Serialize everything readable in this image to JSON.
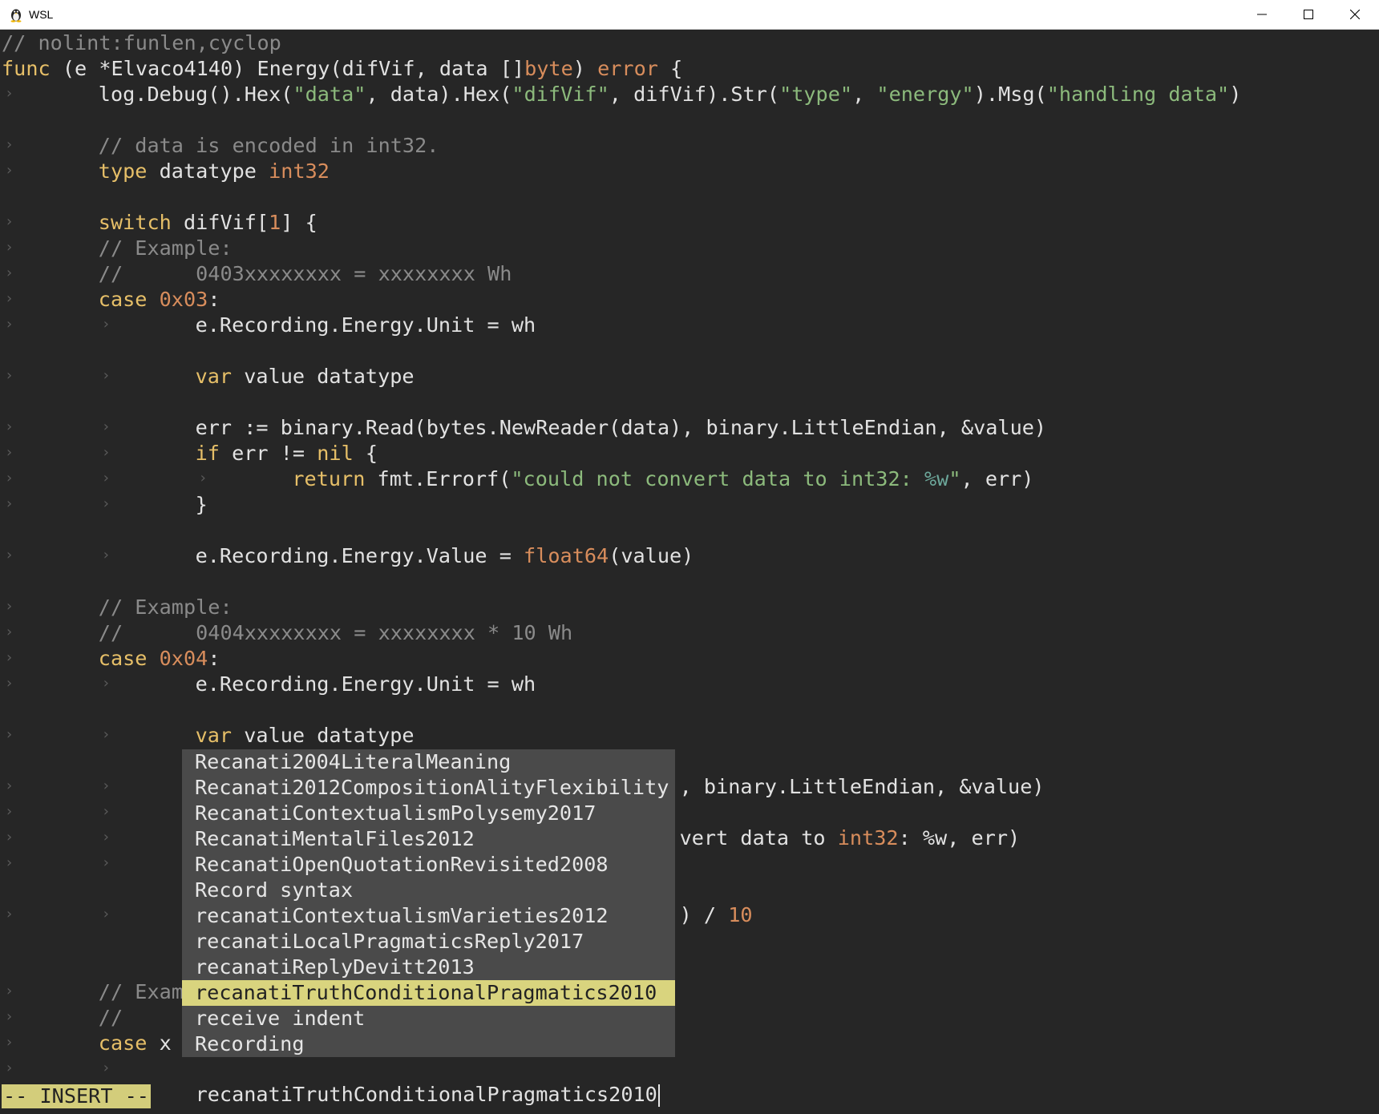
{
  "window": {
    "title": "WSL",
    "icon": "tux-penguin-icon",
    "controls": [
      "minimize-icon",
      "maximize-icon",
      "close-icon"
    ]
  },
  "colors": {
    "background": "#262626",
    "comment": "#8a8a8a",
    "keyword": "#e6bf68",
    "type": "#d88d5c",
    "string": "#8cba7c",
    "text": "#e2e2e2",
    "popup_bg": "#4a4a4a",
    "popup_selected_bg": "#d9d47e",
    "status_bg": "#d3cd7b"
  },
  "lines": [
    {
      "row": 0,
      "text": "// nolint:funlen,cyclop"
    },
    {
      "row": 1,
      "text": "func (e *Elvaco4140) Energy(difVif, data []byte) error {"
    },
    {
      "row": 2,
      "text": "log.Debug().Hex(\"data\", data).Hex(\"difVif\", difVif).Str(\"type\", \"energy\").Msg(\"handling data\")"
    },
    {
      "row": 4,
      "text": "// data is encoded in int32."
    },
    {
      "row": 5,
      "text": "type datatype int32"
    },
    {
      "row": 7,
      "text": "switch difVif[1] {"
    },
    {
      "row": 8,
      "text": "// Example:"
    },
    {
      "row": 9,
      "text": "//      0403xxxxxxxx = xxxxxxxx Wh"
    },
    {
      "row": 10,
      "text": "case 0x03:"
    },
    {
      "row": 11,
      "text": "e.Recording.Energy.Unit = wh"
    },
    {
      "row": 13,
      "text": "var value datatype"
    },
    {
      "row": 15,
      "text": "err := binary.Read(bytes.NewReader(data), binary.LittleEndian, &value)"
    },
    {
      "row": 16,
      "text": "if err != nil {"
    },
    {
      "row": 17,
      "text": "return fmt.Errorf(\"could not convert data to int32: %w\", err)"
    },
    {
      "row": 18,
      "text": "}"
    },
    {
      "row": 20,
      "text": "e.Recording.Energy.Value = float64(value)"
    },
    {
      "row": 22,
      "text": "// Example:"
    },
    {
      "row": 23,
      "text": "//      0404xxxxxxxx = xxxxxxxx * 10 Wh"
    },
    {
      "row": 24,
      "text": "case 0x04:"
    },
    {
      "row": 25,
      "text": "e.Recording.Energy.Unit = wh"
    },
    {
      "row": 27,
      "text": "var value datatype"
    },
    {
      "row": 29,
      "text": ", binary.LittleEndian, &value)"
    },
    {
      "row": 31,
      "text": "vert data to int32: %w\", err)"
    },
    {
      "row": 34,
      "text": ") / 10"
    },
    {
      "row": 37,
      "text": "// Exam"
    },
    {
      "row": 38,
      "text": "//"
    },
    {
      "row": 39,
      "text": "case 0x"
    },
    {
      "row": 41,
      "text": "recanatiTruthConditionalPragmatics2010"
    }
  ],
  "completion_popup": {
    "items": [
      "Recanati2004LiteralMeaning",
      "Recanati2012CompositionAlityFlexibility",
      "RecanatiContextualismPolysemy2017",
      "RecanatiMentalFiles2012",
      "RecanatiOpenQuotationRevisited2008",
      "Record syntax",
      "recanatiContextualismVarieties2012",
      "recanatiLocalPragmaticsReply2017",
      "recanatiReplyDevitt2013",
      "recanatiTruthConditionalPragmatics2010",
      "receive indent",
      "Recording"
    ],
    "selected_index": 9
  },
  "status": {
    "mode": "-- INSERT --"
  }
}
